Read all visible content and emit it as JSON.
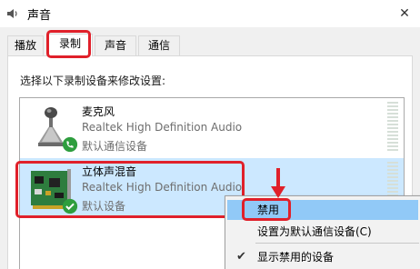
{
  "window": {
    "title": "声音",
    "close_glyph": "✕"
  },
  "tabs": [
    {
      "label": "播放"
    },
    {
      "label": "录制"
    },
    {
      "label": "声音"
    },
    {
      "label": "通信"
    }
  ],
  "instruction": "选择以下录制设备来修改设置:",
  "devices": [
    {
      "name": "麦克风",
      "driver": "Realtek High Definition Audio",
      "status": "默认通信设备",
      "icon": "microphone-icon",
      "badge": "phone-badge-icon"
    },
    {
      "name": "立体声混音",
      "driver": "Realtek High Definition Audio",
      "status": "默认设备",
      "icon": "sound-card-icon",
      "badge": "check-badge-icon"
    }
  ],
  "context_menu": {
    "items": [
      {
        "label": "禁用"
      },
      {
        "label": "设置为默认通信设备(C)"
      },
      {
        "label": "显示禁用的设备",
        "checked": true
      }
    ]
  },
  "colors": {
    "highlight_red": "#e0202a",
    "selected_row": "#cce8ff",
    "menu_hover": "#91c9f7",
    "badge_green": "#2e9e3e"
  }
}
